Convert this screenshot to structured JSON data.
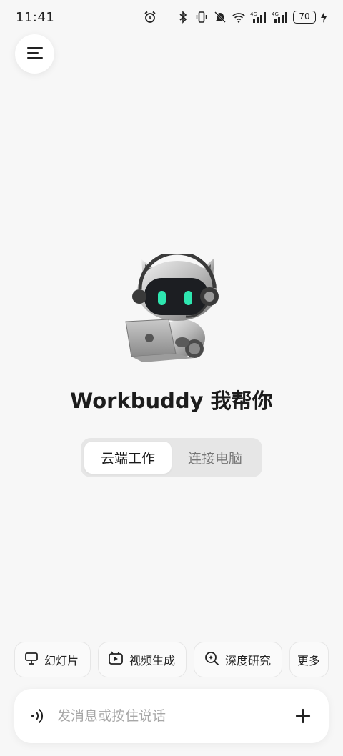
{
  "status_bar": {
    "time": "11:41",
    "battery": "70",
    "icons": [
      "alarm-icon",
      "bluetooth-icon",
      "vibrate-icon",
      "mute-icon",
      "wifi-icon",
      "signal-4g-icon",
      "signal-4g-icon",
      "battery-icon",
      "charging-icon"
    ]
  },
  "menu": {
    "icon": "hamburger-menu-icon"
  },
  "hero": {
    "mascot": "robot-cat-with-laptop",
    "headline": "Workbuddy 我帮你"
  },
  "mode_toggle": {
    "options": [
      {
        "label": "云端工作",
        "active": true
      },
      {
        "label": "连接电脑",
        "active": false
      }
    ]
  },
  "quick_actions": [
    {
      "label": "幻灯片",
      "icon": "presentation-icon"
    },
    {
      "label": "视频生成",
      "icon": "video-icon"
    },
    {
      "label": "深度研究",
      "icon": "deep-search-icon"
    },
    {
      "label": "更多",
      "icon": ""
    }
  ],
  "composer": {
    "placeholder": "发消息或按住说话",
    "value": "",
    "voice_icon": "voice-wave-icon",
    "add_icon": "plus-icon"
  },
  "colors": {
    "background": "#f7f7f7",
    "accent_eyes": "#2ee6b0",
    "toggle_bg": "#e6e6e6"
  }
}
